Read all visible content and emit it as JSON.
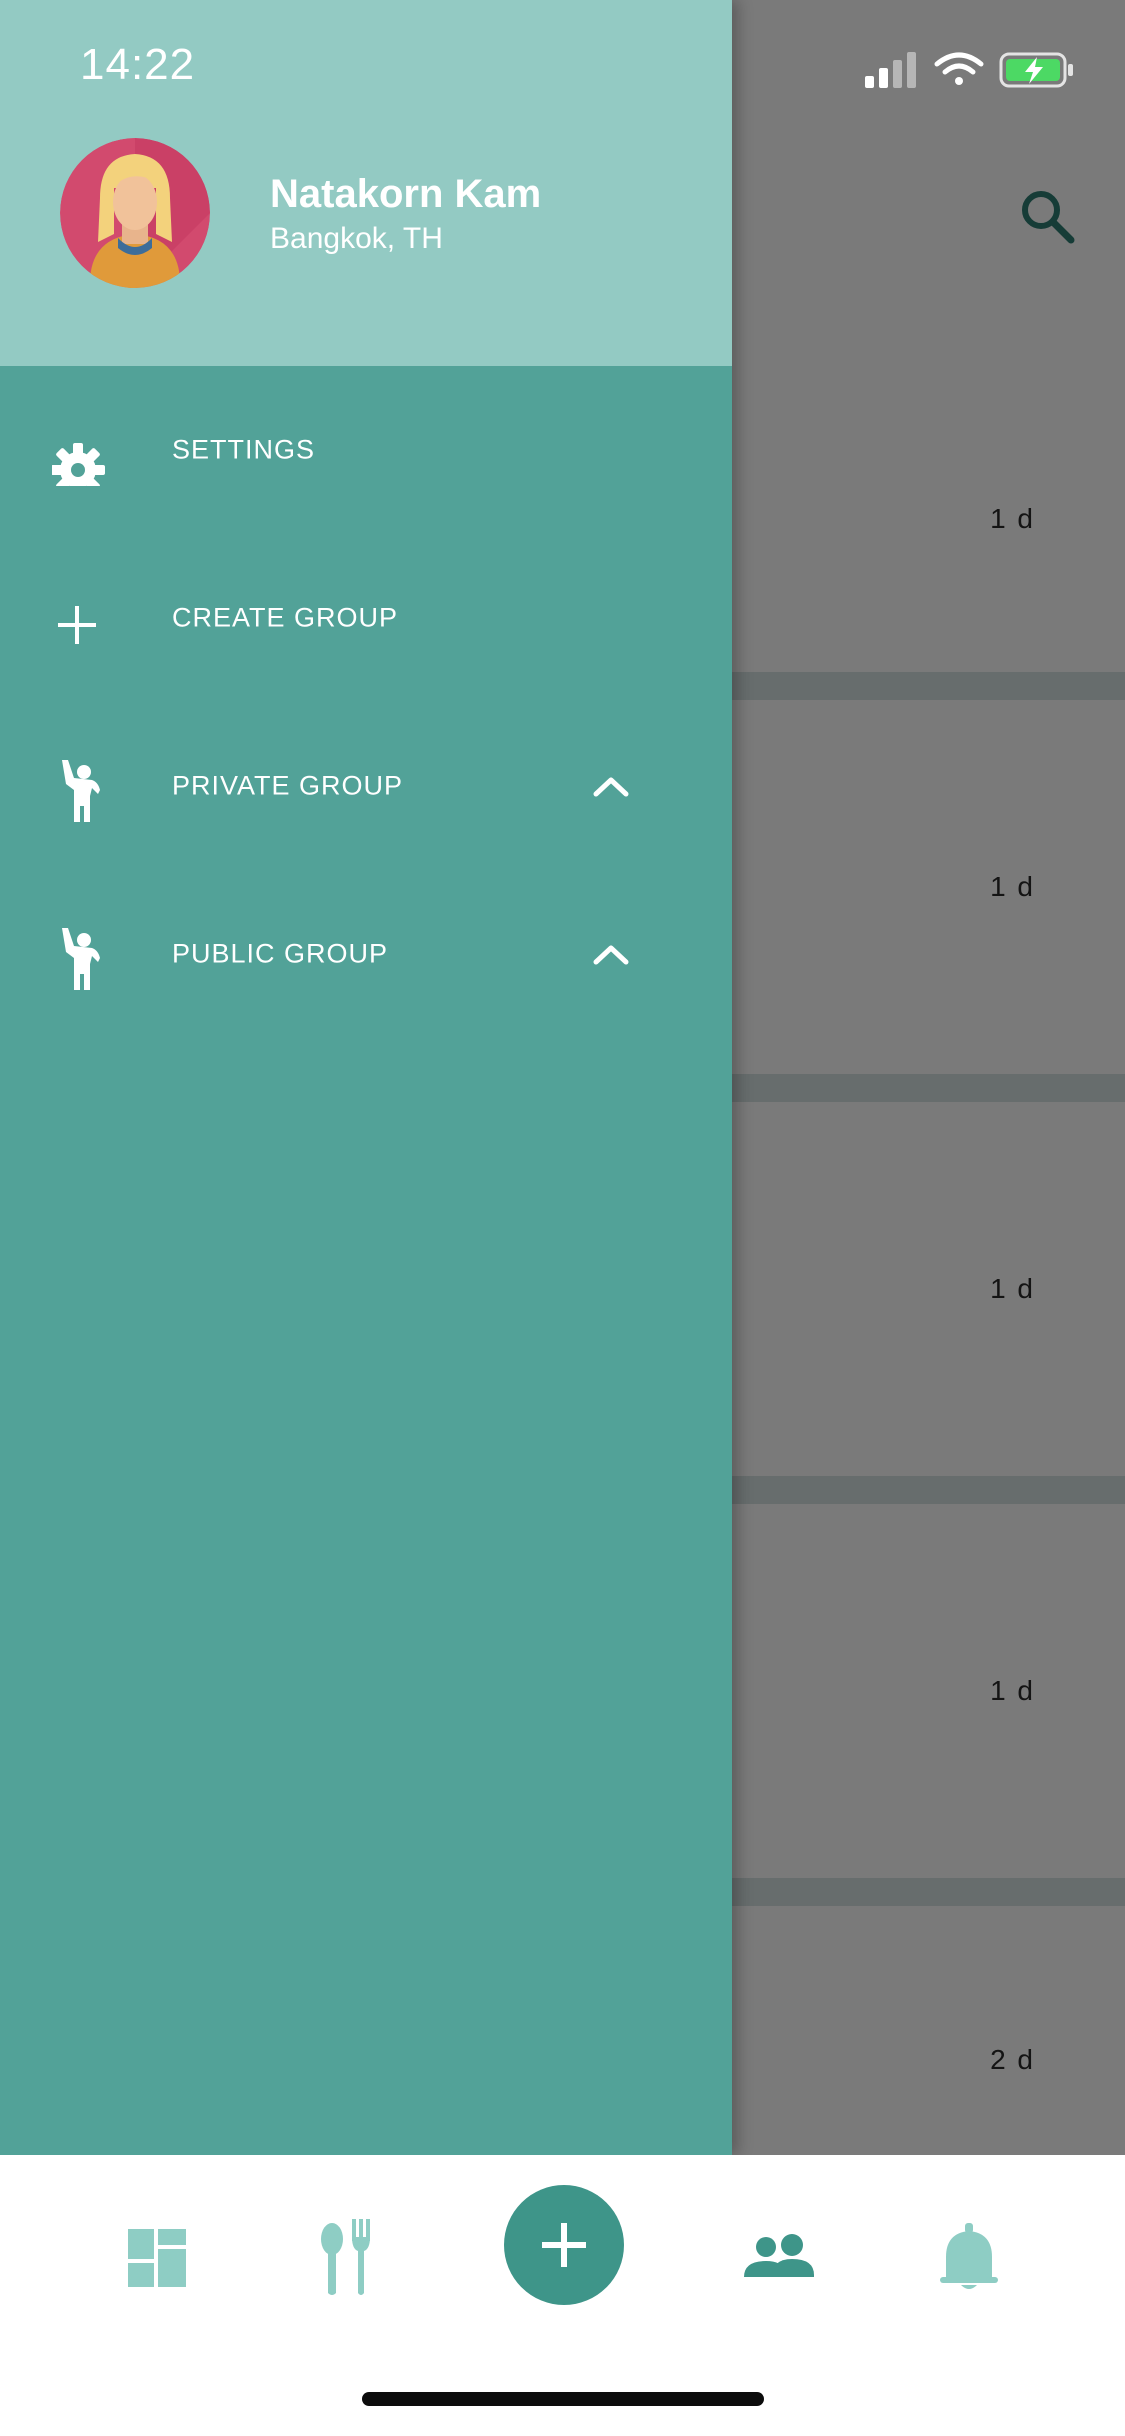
{
  "status_bar": {
    "time": "14:22"
  },
  "user": {
    "name": "Natakorn Kam",
    "location": "Bangkok, TH"
  },
  "menu": [
    {
      "label": "SETTINGS",
      "icon": "gear-icon"
    },
    {
      "label": "CREATE GROUP",
      "icon": "plus-icon"
    },
    {
      "label": "PRIVATE GROUP",
      "icon": "person-waving-icon",
      "expandable": true
    },
    {
      "label": "PUBLIC GROUP",
      "icon": "person-waving-icon",
      "expandable": true
    }
  ],
  "feed": {
    "items": [
      {
        "age": "1 d"
      },
      {
        "age": "1 d"
      },
      {
        "age": "1 d"
      },
      {
        "age": "1 d"
      },
      {
        "age": "2 d"
      }
    ]
  },
  "bottom_nav": {
    "items": [
      "dashboard-icon",
      "spoon-fork-icon",
      "add-icon",
      "people-icon",
      "bell-icon"
    ]
  },
  "colors": {
    "drawer": "#52a298",
    "drawer_header": "#93cac3",
    "accent": "#3e9589",
    "nav_icon": "#8ecdc4"
  }
}
